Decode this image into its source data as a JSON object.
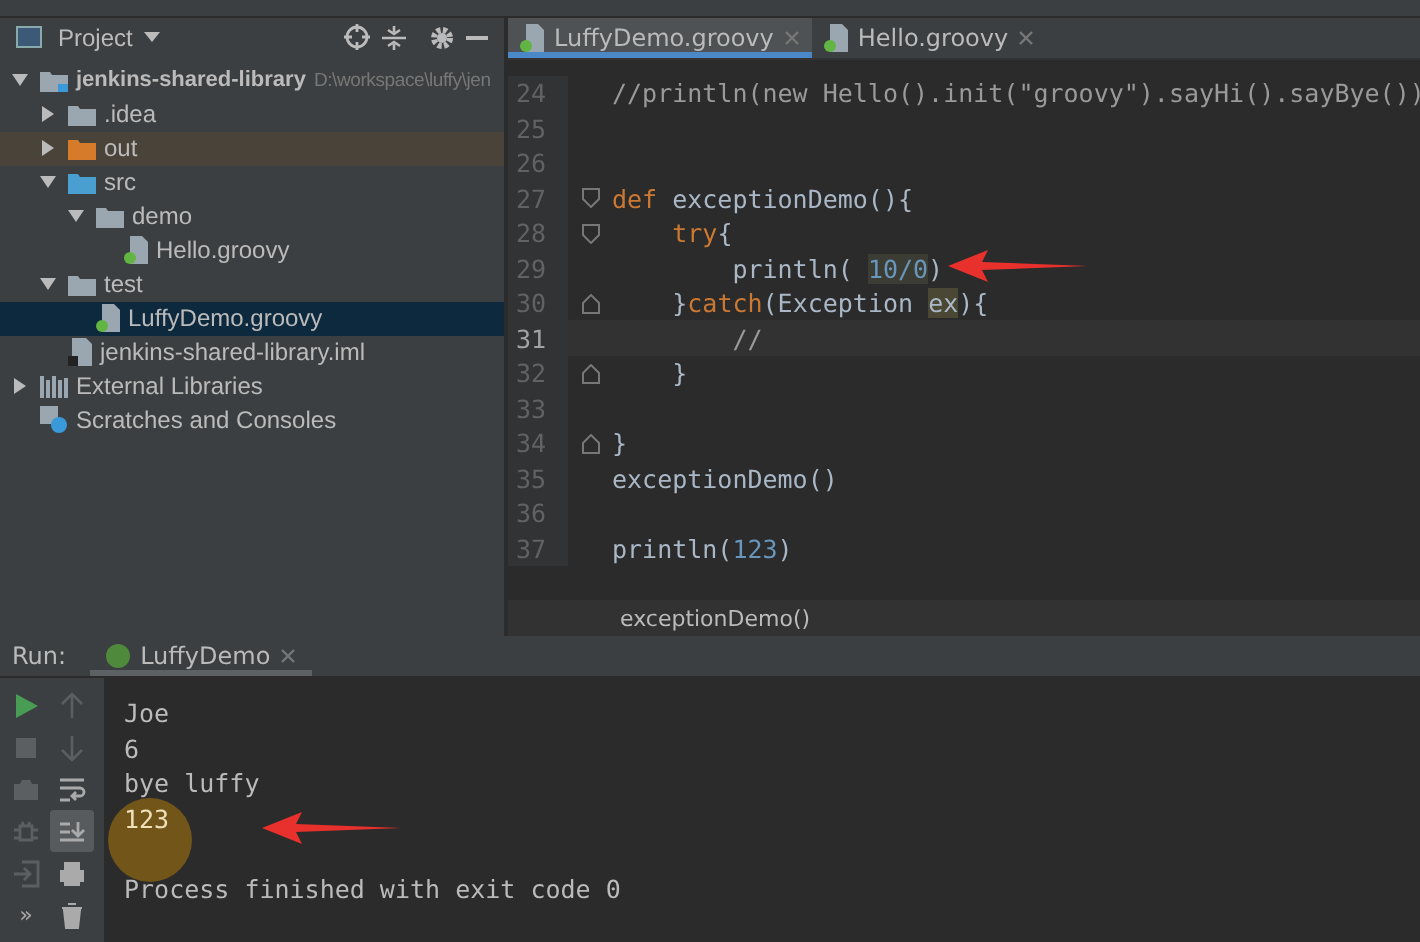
{
  "project": {
    "title": "Project",
    "tree": [
      {
        "label": "jenkins-shared-library",
        "kind": "module",
        "path": "D:\\workspace\\luffy\\jen",
        "expanded": true,
        "selected": false,
        "children": [
          {
            "label": ".idea",
            "kind": "folder",
            "expanded": false,
            "selected": false
          },
          {
            "label": "out",
            "kind": "excluded",
            "expanded": false,
            "selected": false
          },
          {
            "label": "src",
            "kind": "source",
            "expanded": true,
            "selected": false,
            "children": [
              {
                "label": "demo",
                "kind": "package",
                "expanded": true,
                "selected": false,
                "children": [
                  {
                    "label": "Hello.groovy",
                    "kind": "groovy",
                    "selected": false
                  }
                ]
              }
            ]
          },
          {
            "label": "test",
            "kind": "folder",
            "expanded": true,
            "selected": false,
            "children": [
              {
                "label": "LuffyDemo.groovy",
                "kind": "groovy",
                "selected": true
              }
            ]
          },
          {
            "label": "jenkins-shared-library.iml",
            "kind": "iml",
            "selected": false
          }
        ]
      },
      {
        "label": "External Libraries",
        "kind": "libraries",
        "expanded": false,
        "selected": false
      },
      {
        "label": "Scratches and Consoles",
        "kind": "scratches",
        "selected": false
      }
    ]
  },
  "editor": {
    "tabs": [
      {
        "label": "LuffyDemo.groovy",
        "selected": true
      },
      {
        "label": "Hello.groovy",
        "selected": false
      }
    ],
    "lines": [
      {
        "number": "24",
        "current": false,
        "tokens": [
          {
            "text": "//println(new Hello().init(\"groovy\").sayHi().sayBye())",
            "kind": "comment"
          }
        ]
      },
      {
        "number": "25",
        "current": false
      },
      {
        "number": "26",
        "current": false
      },
      {
        "number": "27",
        "current": false,
        "fold_start": true,
        "tokens": [
          {
            "text": "def",
            "kind": "keyword"
          },
          {
            "text": " exceptionDemo(){",
            "kind": "plain"
          }
        ]
      },
      {
        "number": "28",
        "current": false,
        "fold_start": true,
        "tokens": [
          {
            "text": "    try",
            "kind": "keyword"
          },
          {
            "text": "{",
            "kind": "plain"
          }
        ]
      },
      {
        "number": "29",
        "current": false,
        "tokens": [
          {
            "text": "        println( ",
            "kind": "plain"
          },
          {
            "text": "10/0",
            "kind": "number-highlight"
          },
          {
            "text": ")",
            "kind": "plain"
          }
        ]
      },
      {
        "number": "30",
        "current": false,
        "fold_end": true,
        "tokens": [
          {
            "text": "    }",
            "kind": "plain"
          },
          {
            "text": "catch",
            "kind": "keyword"
          },
          {
            "text": "(Exception ",
            "kind": "plain"
          },
          {
            "text": "ex",
            "kind": "highlight"
          },
          {
            "text": "){",
            "kind": "plain"
          }
        ]
      },
      {
        "number": "31",
        "current": true,
        "tokens": [
          {
            "text": "        //",
            "kind": "comment"
          }
        ]
      },
      {
        "number": "32",
        "current": false,
        "fold_end": true,
        "tokens": [
          {
            "text": "    }",
            "kind": "plain"
          }
        ]
      },
      {
        "number": "33",
        "current": false
      },
      {
        "number": "34",
        "current": false,
        "fold_end": true,
        "tokens": [
          {
            "text": "}",
            "kind": "plain"
          }
        ]
      },
      {
        "number": "35",
        "current": false,
        "tokens": [
          {
            "text": "exceptionDemo()",
            "kind": "plain"
          }
        ]
      },
      {
        "number": "36",
        "current": false
      },
      {
        "number": "37",
        "current": false,
        "tokens": [
          {
            "text": "println(",
            "kind": "plain"
          },
          {
            "text": "123",
            "kind": "number"
          },
          {
            "text": ")",
            "kind": "plain"
          }
        ]
      }
    ],
    "breadcrumb": "exceptionDemo()"
  },
  "run": {
    "label": "Run:",
    "tab": {
      "label": "LuffyDemo",
      "selected": true
    },
    "tools": [
      {
        "kind": "run",
        "disabled": false,
        "selected": false
      },
      {
        "kind": "up",
        "disabled": true,
        "selected": false
      },
      {
        "kind": "stop",
        "disabled": true,
        "selected": false
      },
      {
        "kind": "down",
        "disabled": true,
        "selected": false
      },
      {
        "kind": "camera",
        "disabled": true,
        "selected": false
      },
      {
        "kind": "wrap",
        "disabled": false,
        "selected": false
      },
      {
        "kind": "bug",
        "disabled": true,
        "selected": false
      },
      {
        "kind": "scroll-end",
        "disabled": false,
        "selected": true
      },
      {
        "kind": "exit",
        "disabled": true,
        "selected": false
      },
      {
        "kind": "print",
        "disabled": false,
        "selected": false
      },
      {
        "kind": "more",
        "text": "»",
        "disabled": false,
        "selected": false
      },
      {
        "kind": "trash",
        "disabled": false,
        "selected": false
      }
    ],
    "output": [
      {
        "text": "Joe",
        "kind": "stdout"
      },
      {
        "text": "6",
        "kind": "stdout"
      },
      {
        "text": "bye luffy",
        "kind": "stdout"
      },
      {
        "text": "123",
        "kind": "stdout"
      },
      {
        "text": "Process finished with exit code 0",
        "kind": "exit"
      }
    ]
  }
}
